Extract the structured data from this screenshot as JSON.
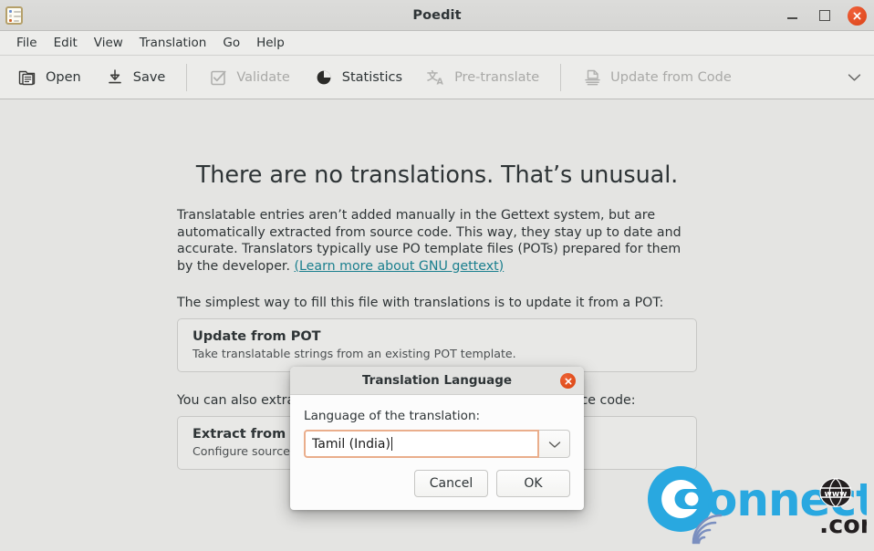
{
  "window": {
    "title": "Poedit",
    "app_icon": "poedit-document-icon",
    "controls": {
      "minimize": "minimize-icon",
      "maximize": "maximize-icon",
      "close": "close-icon"
    }
  },
  "menubar": {
    "items": [
      {
        "label": "File"
      },
      {
        "label": "Edit"
      },
      {
        "label": "View"
      },
      {
        "label": "Translation"
      },
      {
        "label": "Go"
      },
      {
        "label": "Help"
      }
    ]
  },
  "toolbar": {
    "buttons": [
      {
        "label": "Open",
        "icon": "folder-open-icon",
        "disabled": false
      },
      {
        "label": "Save",
        "icon": "save-download-icon",
        "disabled": false
      },
      {
        "label": "Validate",
        "icon": "checklist-icon",
        "disabled": true
      },
      {
        "label": "Statistics",
        "icon": "pie-chart-icon",
        "disabled": false
      },
      {
        "label": "Pre-translate",
        "icon": "translate-icon",
        "disabled": true
      },
      {
        "label": "Update from Code",
        "icon": "update-code-icon",
        "disabled": true
      }
    ],
    "overflow_icon": "chevron-down-icon"
  },
  "content": {
    "headline": "There are no translations. That’s unusual.",
    "intro_text": "Translatable entries aren’t added manually in the Gettext system, but are automatically extracted from source code. This way, they stay up to date and accurate. Translators typically use PO template files (POTs) prepared for them by the developer.",
    "intro_link": "(Learn more about GNU gettext)",
    "lead_pot": "The simplest way to fill this file with translations is to update it from a POT:",
    "card_pot": {
      "title": "Update from POT",
      "subtitle": "Take translatable strings from an existing POT template."
    },
    "lead_sources": "You can also extract translatable strings directly from the source code:",
    "card_sources": {
      "title": "Extract from sources",
      "subtitle": "Configure source code extraction in Properties."
    }
  },
  "watermark": {
    "text_main": "onnect",
    "letter_c": "C",
    "text_dot": ".",
    "text_com": "com",
    "text_www": "w w w",
    "color": "#29a8e0",
    "color_dark": "#231f20"
  },
  "dialog": {
    "title": "Translation Language",
    "close_icon": "close-icon",
    "label": "Language of the translation:",
    "input_value": "Tamil (India)",
    "input_placeholder": "Language of the translation",
    "dropdown_icon": "chevron-down-icon",
    "cancel_label": "Cancel",
    "ok_label": "OK"
  },
  "colors": {
    "window_bg": "#e4e4e2",
    "toolbar_bg": "#ececea",
    "accent_close": "#db4316",
    "focus_border": "#eaae8c",
    "link": "#1a7f8e",
    "watermark_blue": "#29a8e0"
  }
}
